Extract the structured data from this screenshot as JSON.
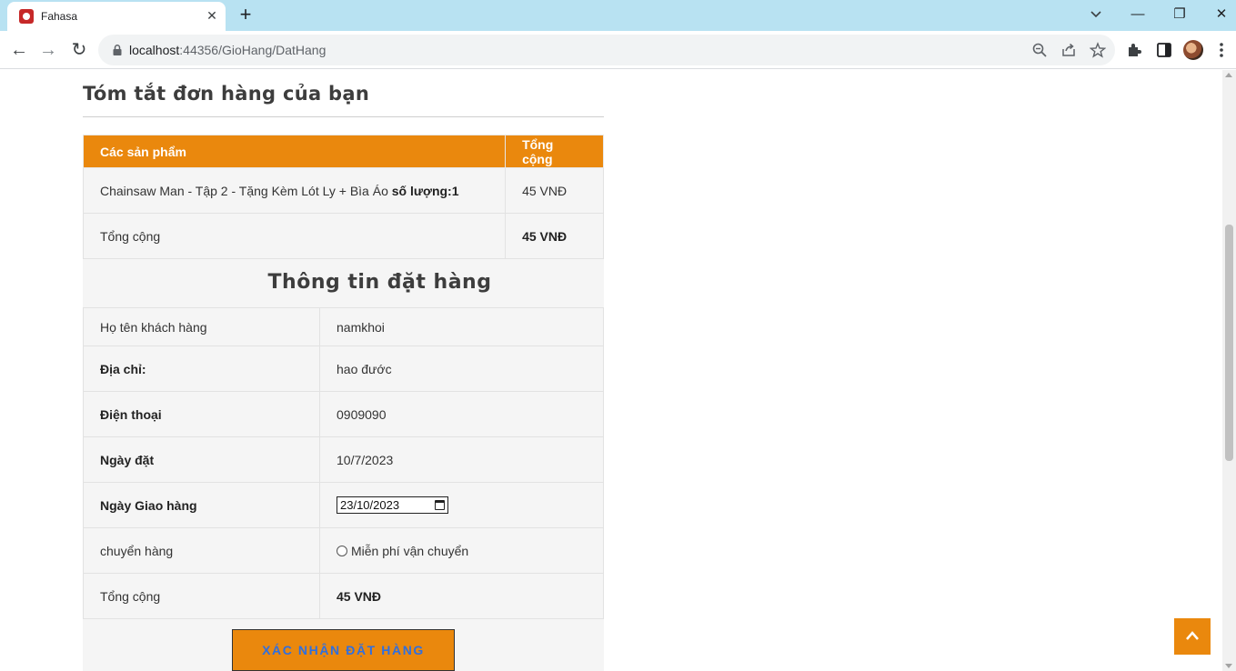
{
  "browser": {
    "tab_title": "Fahasa",
    "url_host": "localhost",
    "url_rest": ":44356/GioHang/DatHang"
  },
  "page": {
    "summary_title": "Tóm tắt đơn hàng của bạn",
    "order_table": {
      "headers": [
        "Các sản phẩm",
        "Tổng cộng"
      ],
      "item_name": "Chainsaw Man - Tập 2 - Tặng Kèm Lót Ly + Bìa Áo",
      "item_qty_label": "số lượng:1",
      "item_total": "45 VNĐ",
      "total_label": "Tổng cộng",
      "total_value": "45 VNĐ"
    },
    "info_title": "Thông tin đặt hàng",
    "info_rows": {
      "name_label": "Họ tên khách hàng",
      "name_value": "namkhoi",
      "address_label": "Địa chỉ:",
      "address_value": "hao đước",
      "phone_label": "Điện thoại",
      "phone_value": "0909090",
      "order_date_label": "Ngày đặt",
      "order_date_value": "10/7/2023",
      "delivery_date_label": "Ngày Giao hàng",
      "delivery_date_value": "23/10/2023",
      "shipping_label": "chuyển hàng",
      "shipping_option": "Miễn phí vận chuyển",
      "total_label": "Tổng cộng",
      "total_value": "45 VNĐ"
    },
    "confirm_button": "XÁC NHẬN ĐẶT HÀNG"
  },
  "colors": {
    "accent": "#ea880d",
    "button_text": "#2f6fe0",
    "tab_strip": "#b8e2f2"
  },
  "icons": [
    "search-icon",
    "share-icon",
    "star-icon",
    "extensions-icon",
    "side-panel-icon",
    "menu-icon",
    "calendar-icon",
    "chevron-up-icon"
  ]
}
